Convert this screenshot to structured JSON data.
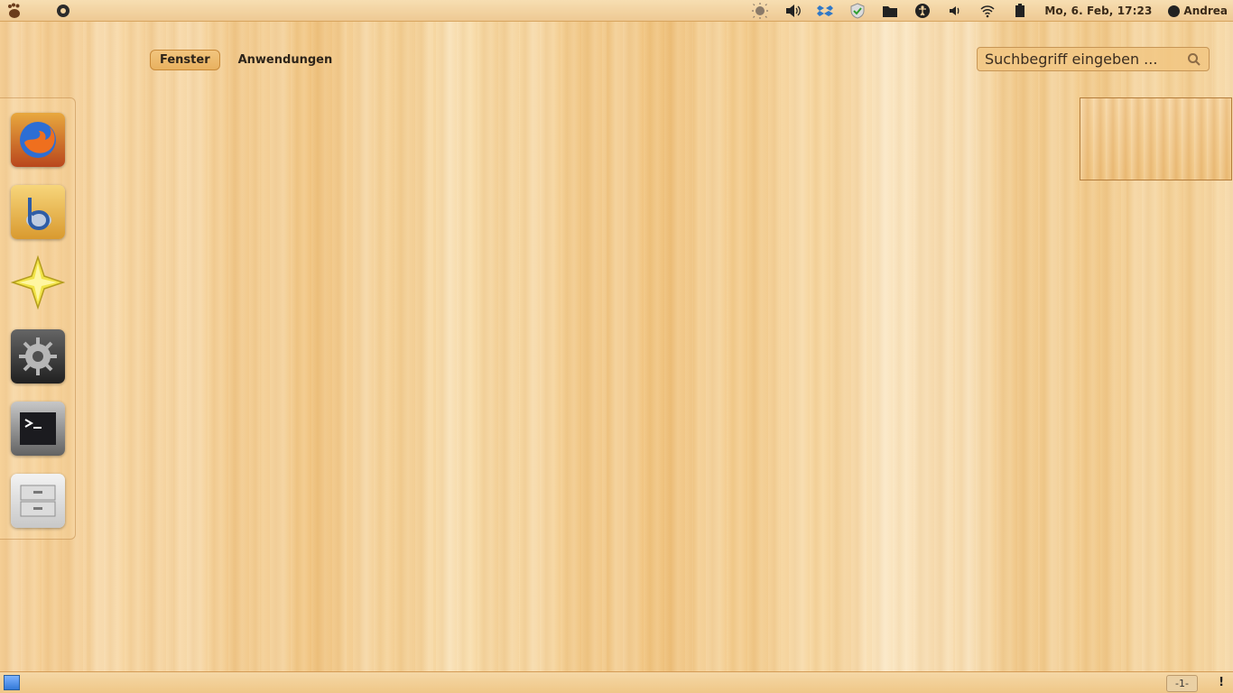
{
  "topbar": {
    "clock": "Mo,  6. Feb, 17:23",
    "user": "Andrea"
  },
  "filters": [
    {
      "label": "Fenster"
    },
    {
      "label": "Anwendungen"
    }
  ],
  "search": {
    "placeholder": "Suchbegriff eingeben ..."
  },
  "launcher": {
    "items": [
      {
        "icon": "firefox-icon"
      },
      {
        "icon": "beatbox-icon"
      },
      {
        "icon": "star-icon"
      },
      {
        "icon": "system-settings-icon"
      },
      {
        "icon": "terminal-icon"
      },
      {
        "icon": "file-cabinet-icon"
      }
    ]
  },
  "bottombar": {
    "workspace": "-1-",
    "notification": "!"
  }
}
